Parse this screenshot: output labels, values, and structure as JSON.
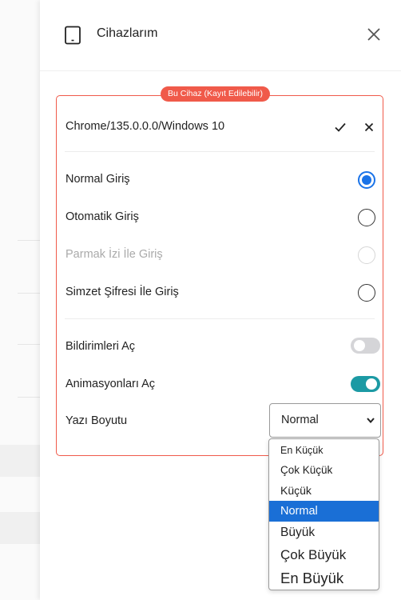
{
  "panel": {
    "title": "Cihazlarım",
    "title_icon": "tablet-icon",
    "close_icon": "close-icon"
  },
  "device_card": {
    "badge": "Bu Cihaz (Kayıt Edilebilir)",
    "device_name": "Chrome/135.0.0.0/Windows 10",
    "accent_color": "#f05a4a"
  },
  "login_options": [
    {
      "label": "Normal Giriş",
      "state": "selected"
    },
    {
      "label": "Otomatik Giriş",
      "state": "unselected"
    },
    {
      "label": "Parmak İzi İle Giriş",
      "state": "disabled"
    },
    {
      "label": "Simzet Şifresi İle Giriş",
      "state": "unselected"
    }
  ],
  "settings": {
    "notifications": {
      "label": "Bildirimleri Aç",
      "enabled": false
    },
    "animations": {
      "label": "Animasyonları Aç",
      "enabled": true,
      "color": "#1c9aa4"
    },
    "font_size": {
      "label": "Yazı Boyutu",
      "selected": "Normal"
    }
  },
  "font_size_options": [
    "En Küçük",
    "Çok Küçük",
    "Küçük",
    "Normal",
    "Büyük",
    "Çok Büyük",
    "En Büyük"
  ],
  "selection_color": "#1a6fd6"
}
